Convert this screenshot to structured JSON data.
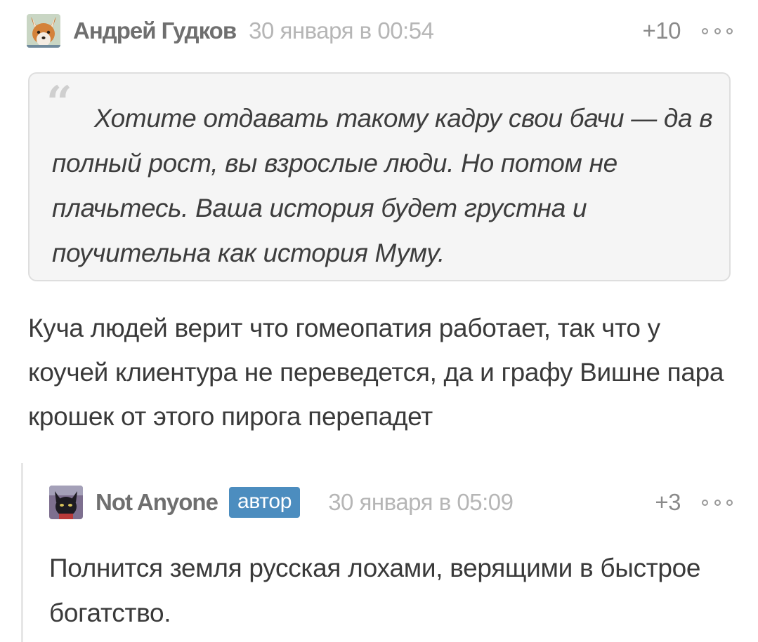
{
  "comments": [
    {
      "author": "Андрей Гудков",
      "date": "30 января в 00:54",
      "rating": "+10",
      "avatar_icon": "fox-avatar",
      "quote": "Хотите отдавать такому кадру свои бачи — да в полный рост, вы взрослые люди. Но потом не плачьтесь. Ваша история будет грустна и поучительна как история Муму.",
      "text": "Куча людей верит что гомеопатия работает, так что у коучей клиентура не переведется, да и графу Вишне пара крошек от этого пирога перепадет"
    },
    {
      "author": "Not Anyone",
      "badge": "автор",
      "date": "30 января в 05:09",
      "rating": "+3",
      "avatar_icon": "black-cat-avatar",
      "text": "Полнится земля русская лохами, верящими в быстрое богатство."
    }
  ],
  "quote_mark": "66",
  "colors": {
    "badge": "#4c8dbf",
    "quote_background": "#f5f5f5",
    "date": "#b6b6b6",
    "author": "#6f6f6f"
  }
}
